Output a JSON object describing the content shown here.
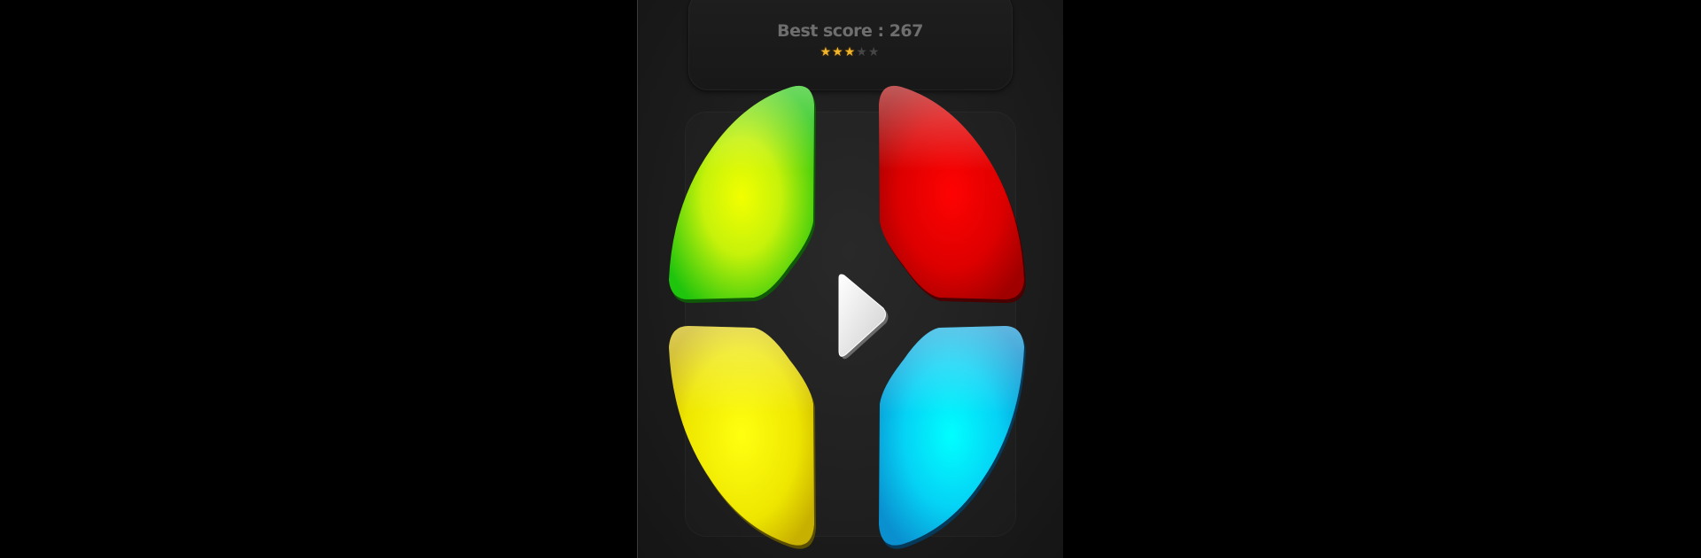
{
  "score": {
    "label": "Best score : 267"
  },
  "rating": {
    "filled": 3,
    "total": 5
  },
  "pads": [
    {
      "id": "green",
      "color": "#2bd60e",
      "center": "#f4ff00"
    },
    {
      "id": "red",
      "color": "#d40000",
      "center": "#ff0000"
    },
    {
      "id": "yellow",
      "color": "#e0d000",
      "center": "#ffff00"
    },
    {
      "id": "blue",
      "color": "#0aa8e6",
      "center": "#00ffff"
    }
  ],
  "play": {
    "icon": "play-icon"
  }
}
